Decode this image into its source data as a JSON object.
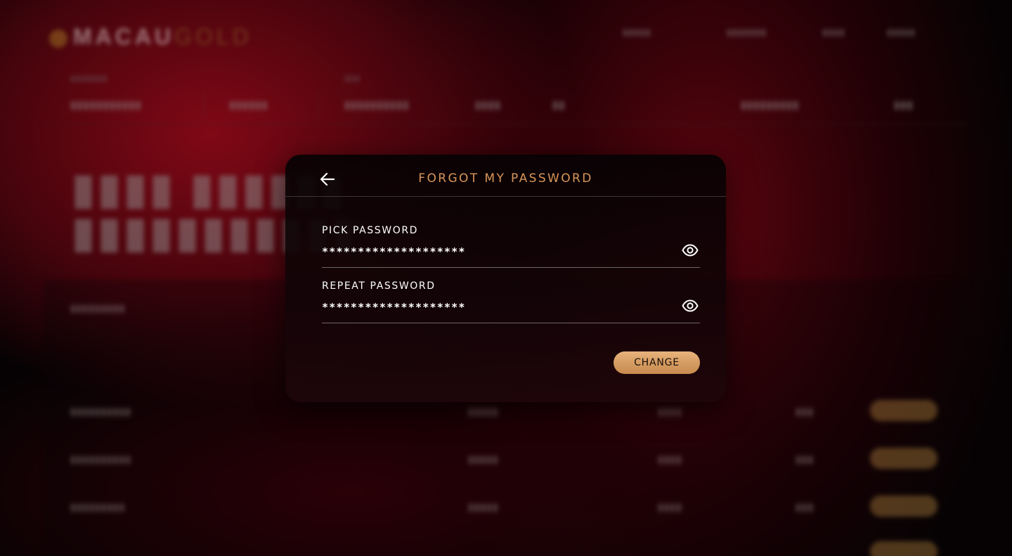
{
  "modal": {
    "title": "FORGOT MY PASSWORD",
    "back_icon": "arrow-left-icon",
    "fields": [
      {
        "label": "PICK PASSWORD",
        "value": "********************",
        "toggle_icon": "eye-icon"
      },
      {
        "label": "REPEAT PASSWORD",
        "value": "********************",
        "toggle_icon": "eye-icon"
      }
    ],
    "submit_label": "CHANGE"
  },
  "colors": {
    "title": "#d9965a",
    "button": "#d49b60",
    "background": "#060203",
    "accent_red": "#960a19"
  }
}
